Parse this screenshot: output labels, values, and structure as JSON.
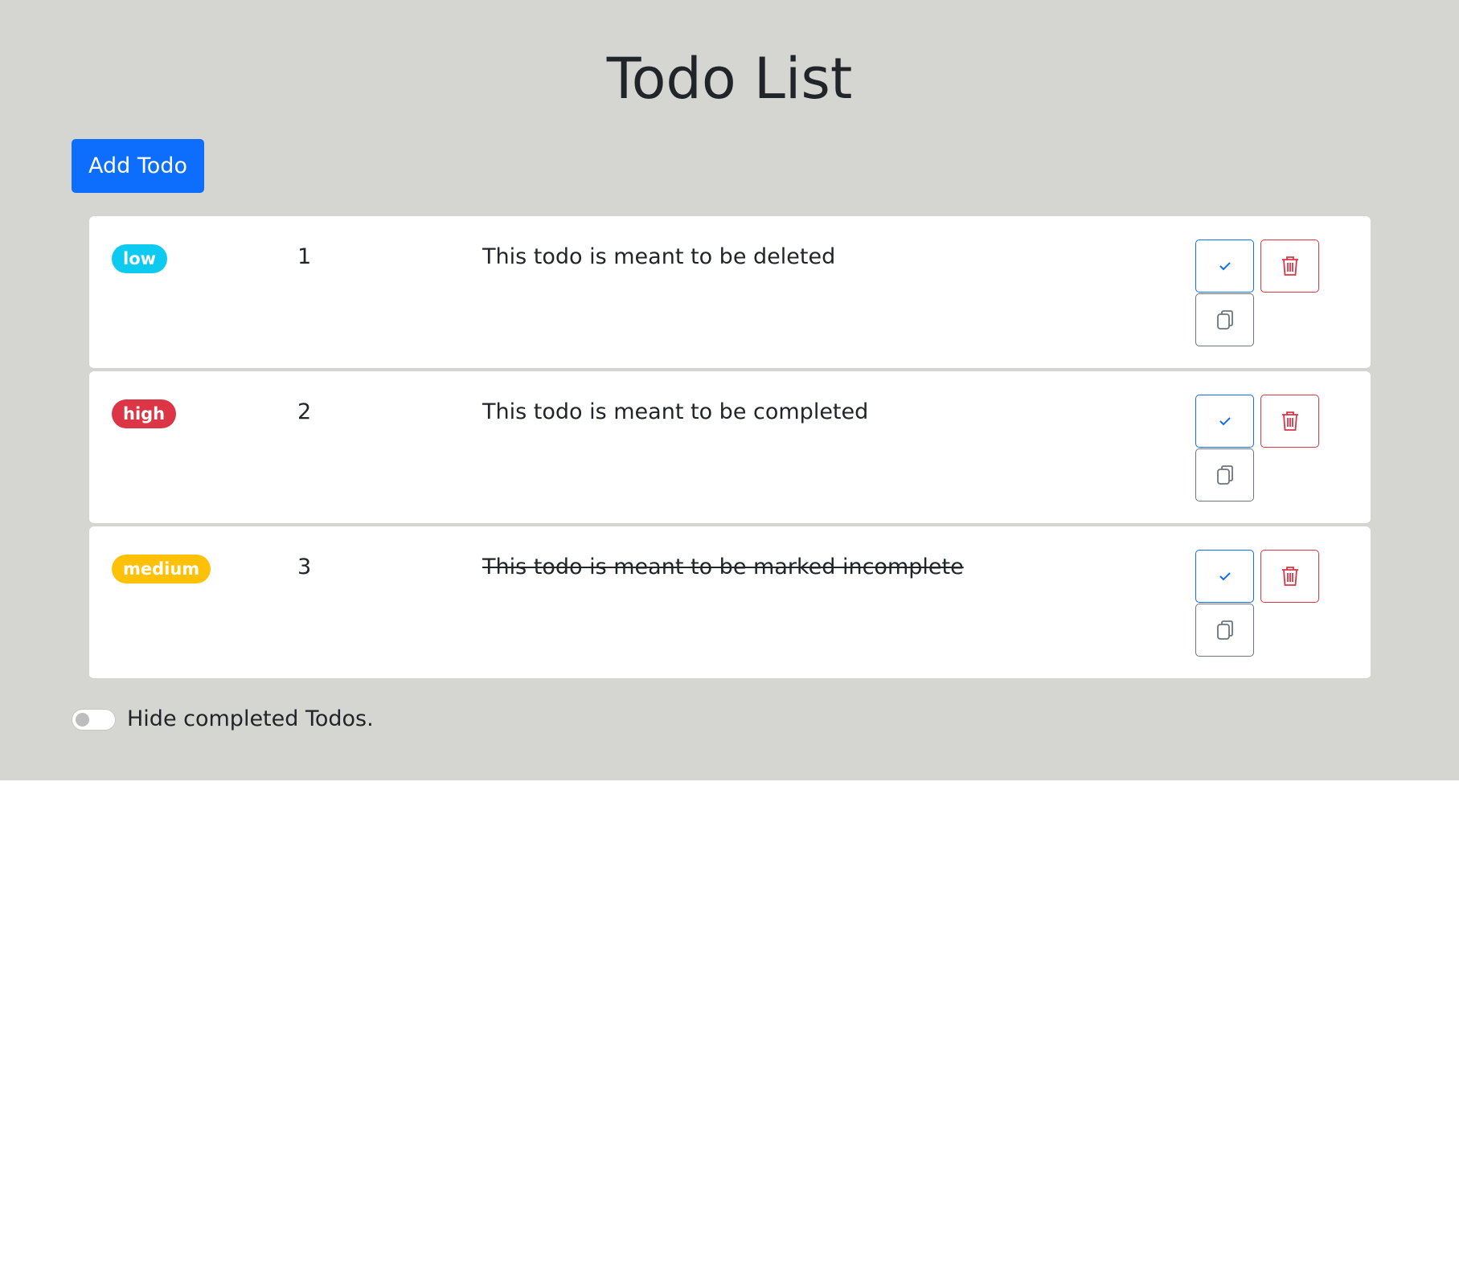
{
  "page": {
    "title": "Todo List"
  },
  "toolbar": {
    "add_label": "Add Todo"
  },
  "colors": {
    "low": "#0dcaf0",
    "high": "#dc3545",
    "medium": "#ffc107",
    "primary": "#0d6efd",
    "danger": "#dc3545",
    "secondary": "#6c757d",
    "background": "#d5d5d1"
  },
  "todos": [
    {
      "priority": "low",
      "number": "1",
      "text": "This todo is meant to be deleted",
      "completed": false
    },
    {
      "priority": "high",
      "number": "2",
      "text": "This todo is meant to be completed",
      "completed": false
    },
    {
      "priority": "medium",
      "number": "3",
      "text": "This todo is meant to be marked incomplete",
      "completed": true
    }
  ],
  "icons": {
    "complete": "check-icon",
    "delete": "trash-icon",
    "copy": "copy-icon"
  },
  "footer": {
    "toggle_label": "Hide completed Todos.",
    "toggle_on": false
  }
}
